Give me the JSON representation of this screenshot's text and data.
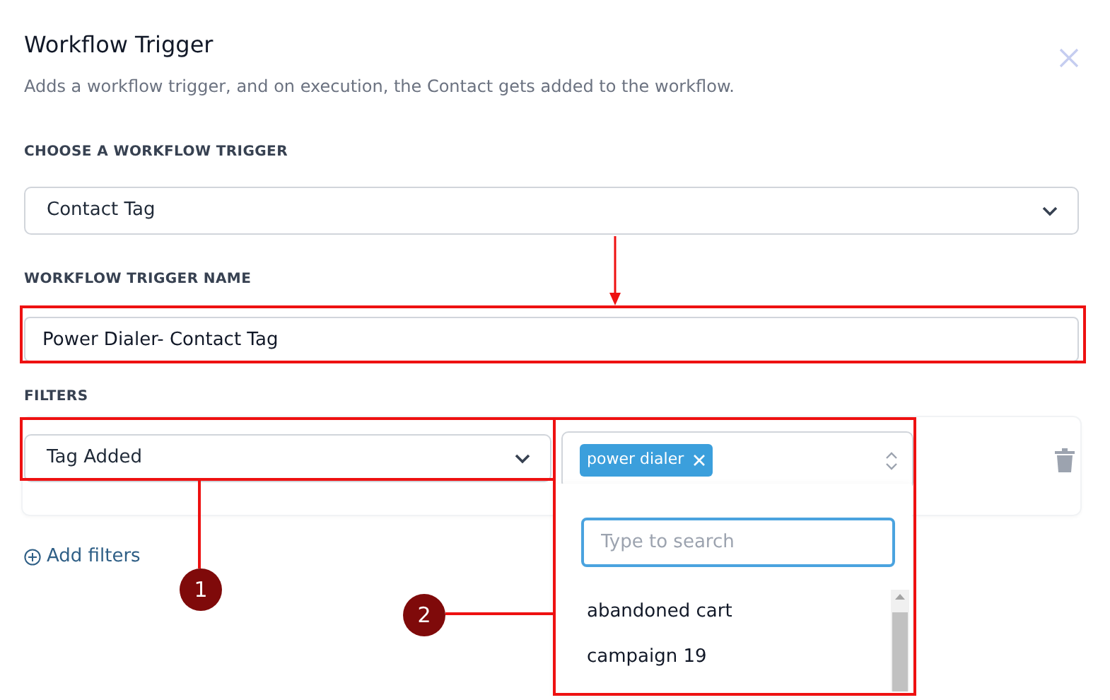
{
  "dialog": {
    "title": "Workflow Trigger",
    "subtitle": "Adds a workflow trigger, and on execution, the Contact gets added to the workflow."
  },
  "trigger": {
    "label": "CHOOSE A WORKFLOW TRIGGER",
    "value": "Contact Tag"
  },
  "trigger_name": {
    "label": "WORKFLOW TRIGGER NAME",
    "value": "Power Dialer- Contact Tag"
  },
  "filters": {
    "label": "FILTERS",
    "condition": "Tag Added",
    "tags": [
      {
        "label": "power dialer"
      }
    ],
    "expanded": true,
    "dropdown": {
      "placeholder": "Type to search",
      "options": [
        {
          "label": "abandoned cart"
        },
        {
          "label": "campaign 19"
        }
      ]
    },
    "add_link": "Add filters"
  },
  "annotations": [
    {
      "label": "1"
    },
    {
      "label": "2"
    }
  ]
}
